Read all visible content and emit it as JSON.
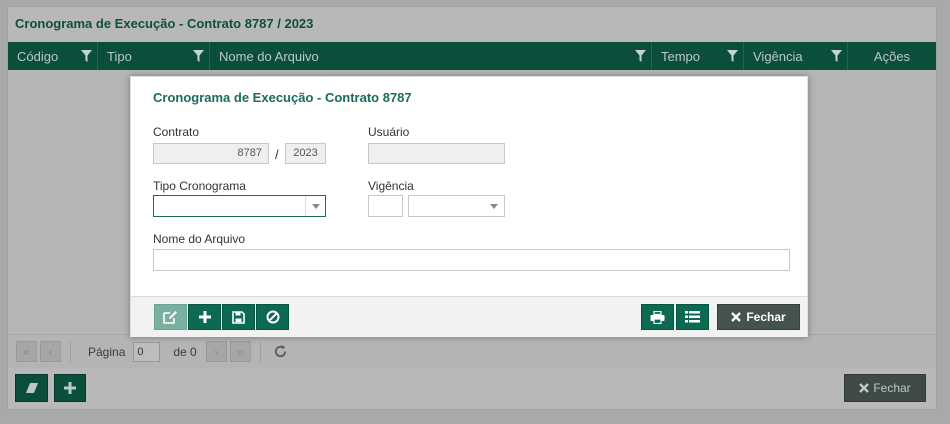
{
  "background": {
    "title": "Cronograma de Execução - Contrato 8787 / 2023",
    "columns": [
      {
        "label": "Código",
        "filter": true
      },
      {
        "label": "Tipo",
        "filter": true
      },
      {
        "label": "Nome do Arquivo",
        "filter": true
      },
      {
        "label": "Tempo",
        "filter": true
      },
      {
        "label": "Vigência",
        "filter": true
      },
      {
        "label": "Ações",
        "filter": false
      }
    ],
    "pager": {
      "page_label": "Página",
      "page_value": "0",
      "of_label": "de 0"
    },
    "close_label": "Fechar"
  },
  "modal": {
    "title": "Cronograma de Execução - Contrato 8787",
    "contrato_label": "Contrato",
    "contrato_number": "8787",
    "contrato_separator": "/",
    "contrato_year": "2023",
    "usuario_label": "Usuário",
    "usuario_value": "",
    "tipo_label": "Tipo Cronograma",
    "tipo_value": "",
    "vigencia_label": "Vigência",
    "vigencia_number": "",
    "vigencia_unit": "",
    "arquivo_label": "Nome do Arquivo",
    "arquivo_value": "",
    "close_label": "Fechar"
  },
  "colors": {
    "primary": "#0c6a52",
    "header": "#0c4e3c",
    "title": "#1c6b5b",
    "close": "#46524d"
  },
  "icons": [
    "funnel-icon",
    "first-page-icon",
    "prev-page-icon",
    "next-page-icon",
    "last-page-icon",
    "refresh-icon",
    "eraser-icon",
    "plus-icon",
    "edit-icon",
    "save-icon",
    "cancel-icon",
    "print-icon",
    "list-icon",
    "close-x-icon"
  ]
}
